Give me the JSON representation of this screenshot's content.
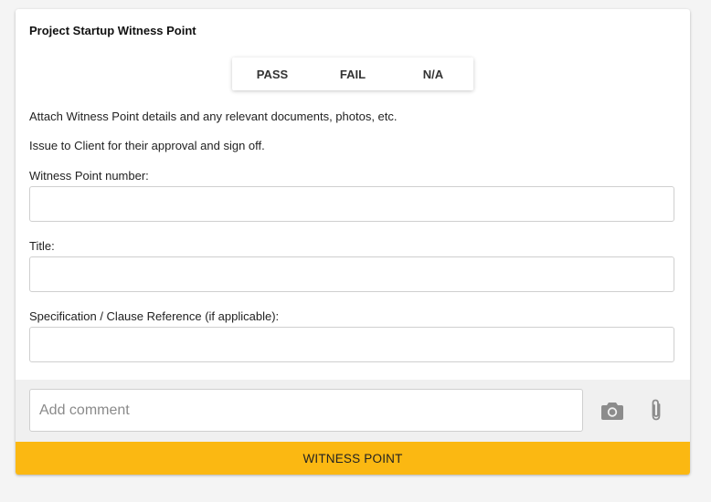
{
  "card": {
    "title": "Project Startup Witness Point"
  },
  "result_options": [
    {
      "label": "PASS"
    },
    {
      "label": "FAIL"
    },
    {
      "label": "N/A"
    }
  ],
  "instructions": {
    "attach": "Attach Witness Point details and any relevant documents, photos, etc.",
    "issue": "Issue to Client for their approval and sign off."
  },
  "fields": {
    "witness_point_number": {
      "label": "Witness Point number:",
      "value": ""
    },
    "title": {
      "label": "Title:",
      "value": ""
    },
    "spec_reference": {
      "label": "Specification / Clause Reference (if applicable):",
      "value": ""
    }
  },
  "comment": {
    "placeholder": "Add comment",
    "camera_icon": "camera-icon",
    "attach_icon": "paperclip-icon"
  },
  "action": {
    "label": "WITNESS POINT",
    "color": "#fbb812"
  }
}
